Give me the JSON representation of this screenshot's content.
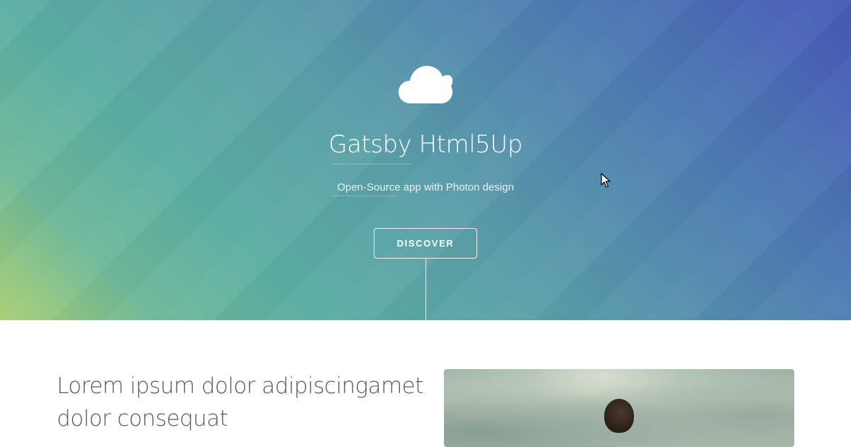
{
  "hero": {
    "logo_icon": "cloud-icon",
    "title": "Gatsby Html5Up",
    "subtitle": "Open-Source app with Photon design",
    "cta_label": "DISCOVER",
    "gradient_colors": [
      "#a9cf73",
      "#5aaea3",
      "#4659b8"
    ]
  },
  "intro": {
    "heading": "Lorem ipsum dolor adipiscingamet dolor consequat",
    "image_alt": "photo of a person against a cloudy sky"
  },
  "cursor": {
    "icon": "arrow-cursor-icon"
  }
}
